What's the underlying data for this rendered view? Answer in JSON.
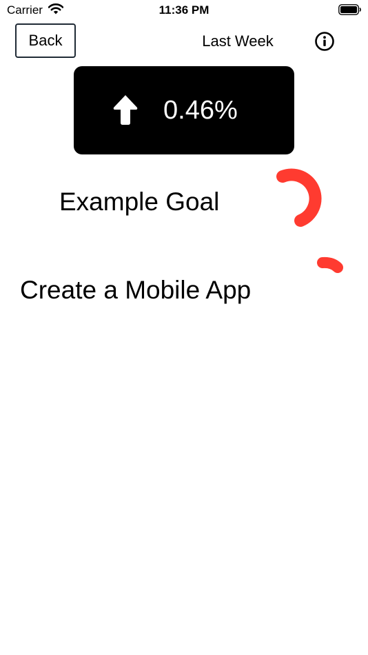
{
  "status_bar": {
    "carrier": "Carrier",
    "time": "11:36 PM",
    "icons": [
      "wifi-icon",
      "battery-icon"
    ]
  },
  "nav": {
    "back_label": "Back",
    "range_label": "Last Week",
    "info_icon": "info-icon"
  },
  "summary": {
    "direction_icon": "arrow-up-icon",
    "change_value": "0.46%"
  },
  "goals": [
    {
      "title": "Example Goal",
      "progress_color": "#ff3b30"
    },
    {
      "title": "Create a Mobile App",
      "progress_color": "#ff3b30"
    }
  ],
  "colors": {
    "accent": "#ff3b30",
    "card_background": "#000000",
    "button_border": "#1f2a35"
  }
}
